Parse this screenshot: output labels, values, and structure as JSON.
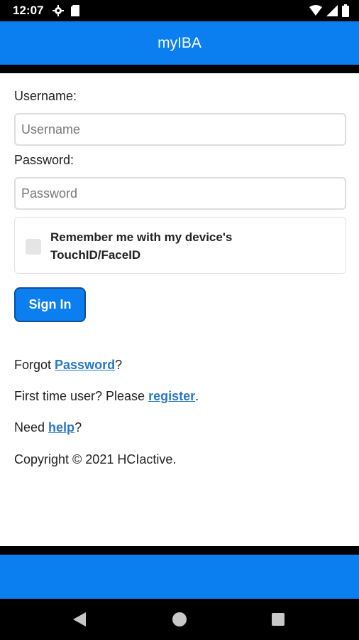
{
  "status_bar": {
    "time": "12:07",
    "left_icons": [
      "gear-icon",
      "sd-card-icon"
    ],
    "right_icons": [
      "wifi-icon",
      "signal-icon",
      "battery-icon"
    ]
  },
  "header": {
    "title": "myIBA"
  },
  "form": {
    "username_label": "Username:",
    "username_placeholder": "Username",
    "username_value": "",
    "password_label": "Password:",
    "password_placeholder": "Password",
    "password_value": "",
    "remember_label": "Remember me with my device's TouchID/FaceID",
    "remember_checked": false,
    "signin_label": "Sign In"
  },
  "links": {
    "forgot_prefix": "Forgot ",
    "forgot_link": "Password",
    "forgot_suffix": "?",
    "register_prefix": "First time user? Please ",
    "register_link": "register",
    "register_suffix": ".",
    "help_prefix": "Need ",
    "help_link": "help",
    "help_suffix": "?"
  },
  "copyright": "Copyright © 2021 HCIactive.",
  "nav": {
    "icons": [
      "back-icon",
      "home-icon",
      "recents-icon"
    ]
  },
  "colors": {
    "brand": "#0b7ff0",
    "link": "#2a77c2"
  }
}
